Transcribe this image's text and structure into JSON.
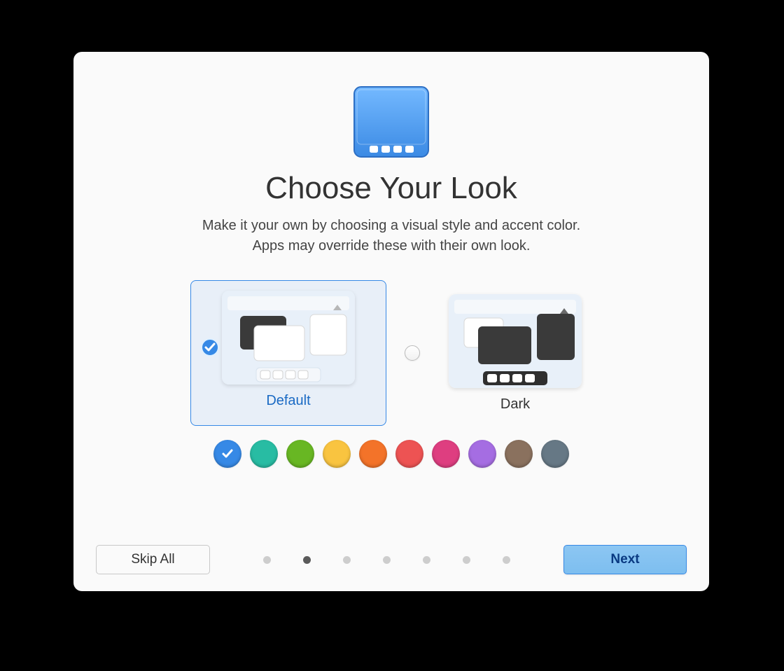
{
  "header": {
    "title": "Choose Your Look",
    "subtitle_line1": "Make it your own by choosing a visual style and accent color.",
    "subtitle_line2": "Apps may override these with their own look."
  },
  "themes": [
    {
      "id": "default",
      "label": "Default",
      "selected": true
    },
    {
      "id": "dark",
      "label": "Dark",
      "selected": false
    }
  ],
  "accent_colors": [
    {
      "name": "blue",
      "hex": "#3689e6",
      "selected": true
    },
    {
      "name": "mint",
      "hex": "#28bca3",
      "selected": false
    },
    {
      "name": "green",
      "hex": "#68b723",
      "selected": false
    },
    {
      "name": "yellow",
      "hex": "#f9c440",
      "selected": false
    },
    {
      "name": "orange",
      "hex": "#f37329",
      "selected": false
    },
    {
      "name": "red",
      "hex": "#ed5353",
      "selected": false
    },
    {
      "name": "pink",
      "hex": "#de3e80",
      "selected": false
    },
    {
      "name": "purple",
      "hex": "#a56de2",
      "selected": false
    },
    {
      "name": "brown",
      "hex": "#8a715e",
      "selected": false
    },
    {
      "name": "slate",
      "hex": "#667885",
      "selected": false
    }
  ],
  "pager": {
    "total": 7,
    "active_index": 1
  },
  "footer": {
    "skip_label": "Skip All",
    "next_label": "Next"
  }
}
